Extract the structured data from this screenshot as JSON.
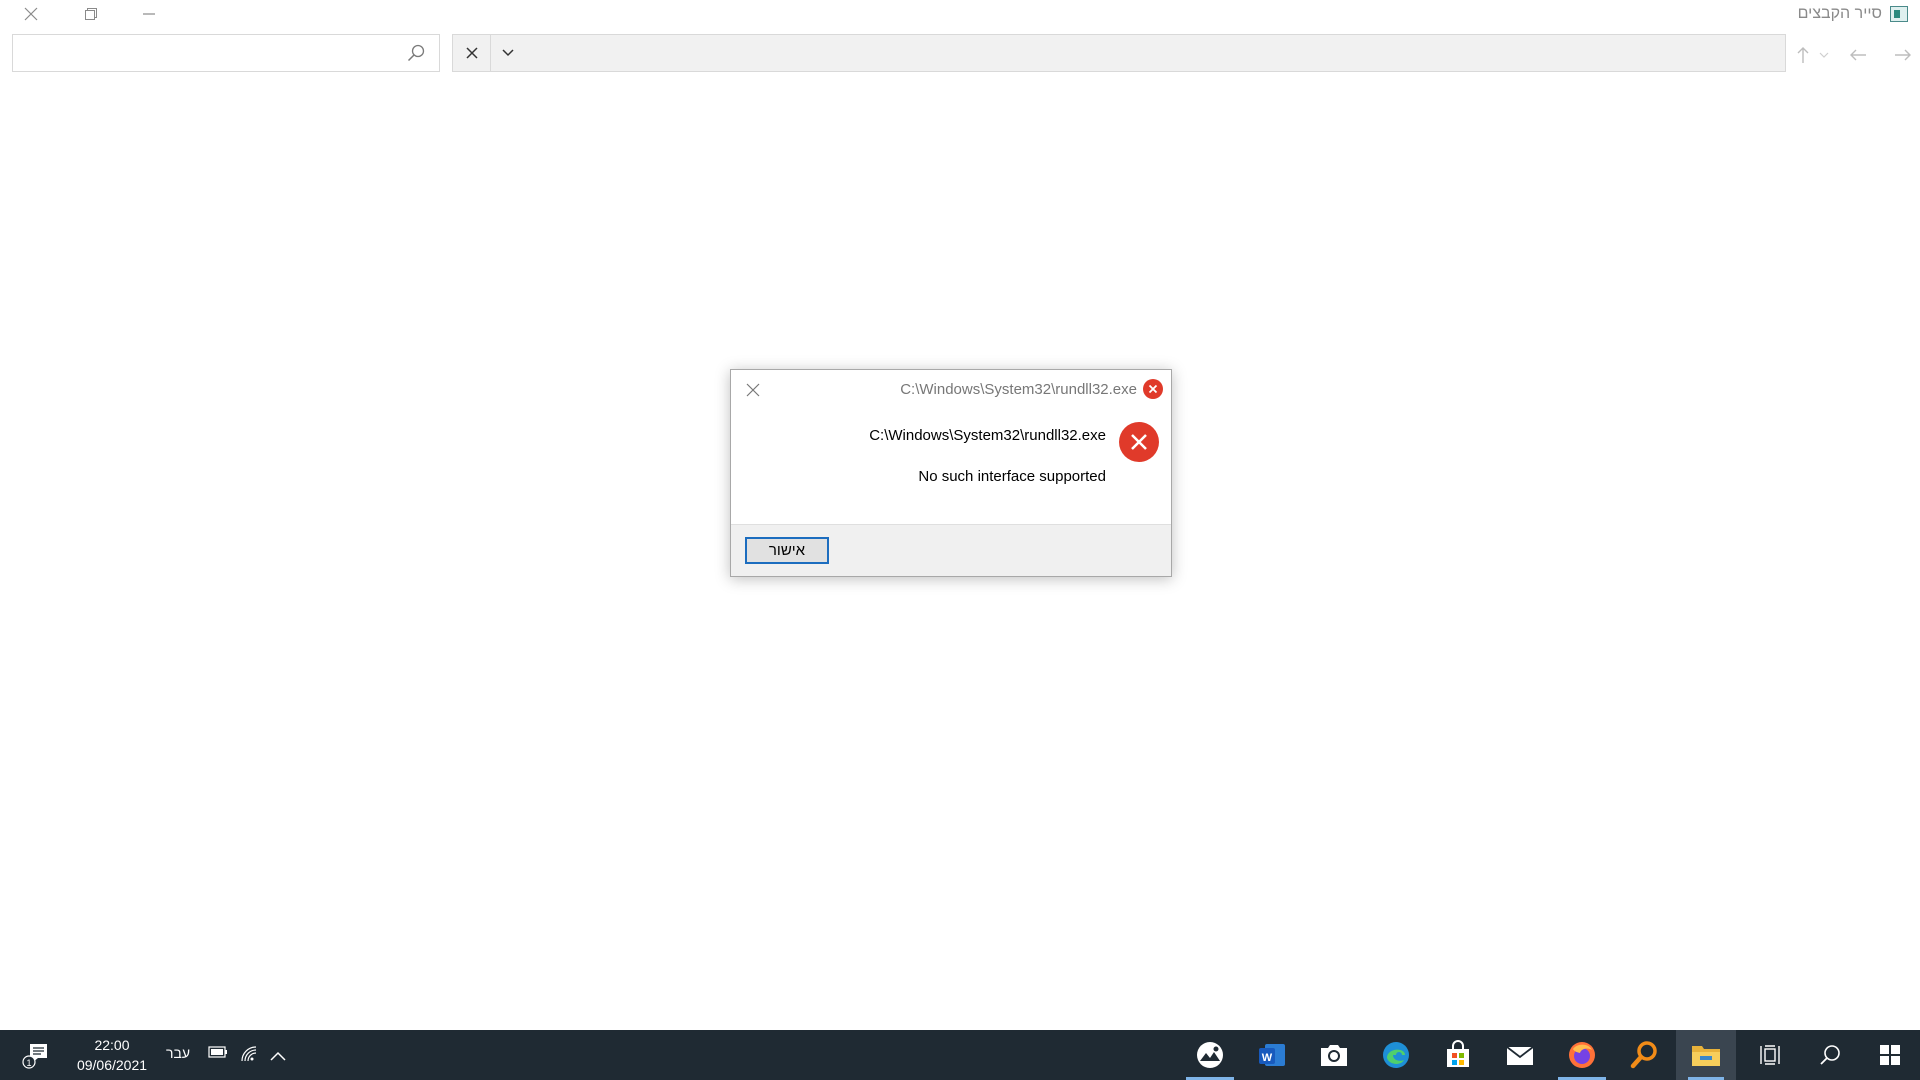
{
  "window": {
    "title": "סייר הקבצים"
  },
  "dialog": {
    "title": "C:\\Windows\\System32\\rundll32.exe",
    "message_path": "C:\\Windows\\System32\\rundll32.exe",
    "message_error": "No such interface supported",
    "ok_label": "אישור"
  },
  "taskbar": {
    "time": "22:00",
    "date": "09/06/2021",
    "language": "עבר",
    "notification_count": "1"
  },
  "icons": {
    "accent": "#1c6dbf",
    "error": "#e03a2a",
    "taskbar_bg": "#1f2a33"
  }
}
